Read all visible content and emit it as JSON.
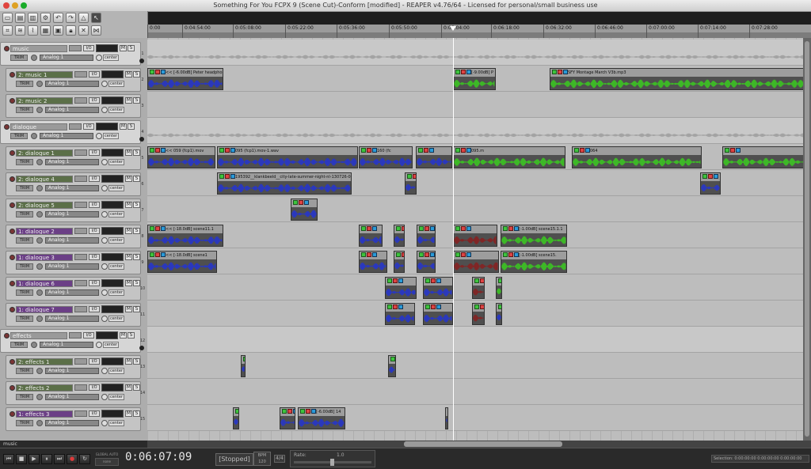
{
  "window": {
    "title": "Something For You FCPX 9 (Scene Cut)-Conform [modified] - REAPER v4.76/64 - Licensed for personal/small business use"
  },
  "ruler": {
    "labels": [
      "0:00",
      "0:04:54:00",
      "0:05:08:00",
      "0:05:22:00",
      "0:05:36:00",
      "0:05:50:00",
      "0:06:04:00",
      "0:06:18:00",
      "0:06:32:00",
      "0:06:46:00",
      "0:07:00:00",
      "0:07:14:00",
      "0:07:28:00"
    ]
  },
  "tracks": [
    {
      "num": "1",
      "name": "music",
      "folder": true,
      "color": "#9a9a9a",
      "input": "Analog 1",
      "trim": "TRIM",
      "pan": "center",
      "io": "I/O",
      "mute": "M",
      "solo": "S"
    },
    {
      "num": "2",
      "name": "2: music 1",
      "color": "#5b6f48",
      "input": "Analog 1",
      "trim": "TRIM",
      "pan": "center",
      "io": "I/O",
      "mute": "M",
      "solo": "S"
    },
    {
      "num": "3",
      "name": "2: music 2",
      "color": "#5b6f48",
      "input": "Analog 1",
      "trim": "TRIM",
      "pan": "center",
      "io": "I/O",
      "mute": "M",
      "solo": "S"
    },
    {
      "num": "4",
      "name": "dialogue",
      "folder": true,
      "color": "#9a9a9a",
      "input": "Analog 1",
      "trim": "TRIM",
      "pan": "center",
      "io": "I/O",
      "mute": "M",
      "solo": "S"
    },
    {
      "num": "5",
      "name": "2: dialogue 1",
      "color": "#5b6f48",
      "input": "Analog 1",
      "trim": "TRIM",
      "pan": "center",
      "io": "I/O",
      "mute": "M",
      "solo": "S"
    },
    {
      "num": "6",
      "name": "2: dialogue 4",
      "color": "#5b6f48",
      "input": "Analog 1",
      "trim": "TRIM",
      "pan": "center",
      "io": "I/O",
      "mute": "M",
      "solo": "S"
    },
    {
      "num": "7",
      "name": "2: dialogue 5",
      "color": "#5b6f48",
      "input": "Analog 1",
      "trim": "TRIM",
      "pan": "center",
      "io": "I/O",
      "mute": "M",
      "solo": "S"
    },
    {
      "num": "8",
      "name": "1: dialogue 2",
      "color": "#6b3f86",
      "input": "Analog 1",
      "trim": "TRIM",
      "pan": "center",
      "io": "I/O",
      "mute": "M",
      "solo": "S"
    },
    {
      "num": "9",
      "name": "1: dialogue 3",
      "color": "#6b3f86",
      "input": "Analog 1",
      "trim": "TRIM",
      "pan": "center",
      "io": "I/O",
      "mute": "M",
      "solo": "S"
    },
    {
      "num": "10",
      "name": "1: dialogue 6",
      "color": "#6b3f86",
      "input": "Analog 1",
      "trim": "TRIM",
      "pan": "center",
      "io": "I/O",
      "mute": "M",
      "solo": "S"
    },
    {
      "num": "11",
      "name": "1: dialogue 7",
      "color": "#6b3f86",
      "input": "Analog 1",
      "trim": "TRIM",
      "pan": "center",
      "io": "I/O",
      "mute": "M",
      "solo": "S"
    },
    {
      "num": "12",
      "name": "effects",
      "folder": true,
      "color": "#9a9a9a",
      "input": "Analog 1",
      "trim": "TRIM",
      "pan": "center",
      "io": "I/O",
      "mute": "M",
      "solo": "S"
    },
    {
      "num": "13",
      "name": "2: effects 1",
      "color": "#5b6f48",
      "input": "Analog 1",
      "trim": "TRIM",
      "pan": "center",
      "io": "I/O",
      "mute": "M",
      "solo": "S"
    },
    {
      "num": "14",
      "name": "2: effects 2",
      "color": "#5b6f48",
      "input": "Analog 1",
      "trim": "TRIM",
      "pan": "center",
      "io": "I/O",
      "mute": "M",
      "solo": "S"
    },
    {
      "num": "15",
      "name": "1: effects 3",
      "color": "#6b3f86",
      "input": "Analog 1",
      "trim": "TRIM",
      "pan": "center",
      "io": "I/O",
      "mute": "M",
      "solo": "S"
    }
  ],
  "items": {
    "music1_a": "<< [-6.00dB] Peter headphones",
    "music1_b": "[-9.00dB] P",
    "music1_c": "SFY Montage March V3b.mp3",
    "dlg1_a": "<< 059 (fcp1).mov",
    "dlg1_b": "095 (fcp1).mov-1.wav",
    "dlg1_c": "095 (fc",
    "dlg1_d": "160 (fc",
    "dlg1_e": "095.m",
    "dlg1_f": "064",
    "dlg4_a": "195392__klankbeeld__city-late-summer-night-nl-130726-0",
    "dlg2_a": "<< [-18.0dB] scene11.1",
    "dlg2_b": "[-1.00dB] scene15.1.1",
    "dlg3_a": "<< [-18.0dB] scene1",
    "dlg3_b": "[-1.00dB] scene15.",
    "fx3_a": "[-6.00dB] 14"
  },
  "status": {
    "selected_track": "music"
  },
  "transport": {
    "timecode": "0:06:07:09",
    "state": "[Stopped]",
    "bpm_label": "BPM",
    "bpm": "120",
    "timesig": "4/4",
    "rate_label": "Rate:",
    "rate": "1.0",
    "global_auto": "GLOBAL AUTO",
    "global_auto_mode": "none",
    "selection": "Selection: 0:00:00:00 0:00:00:00 0:00:00:00"
  },
  "colors": {
    "wave_blue": "#2233d8",
    "wave_green": "#39d21d",
    "wave_red": "#8c1c1c",
    "item_dark": "#4f4f4f"
  }
}
